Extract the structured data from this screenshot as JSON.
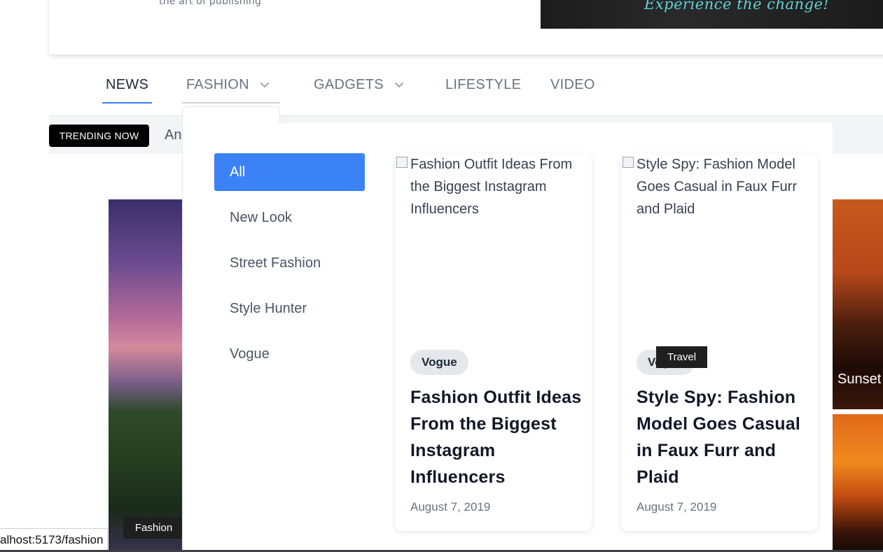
{
  "header": {
    "tagline": "the art of publishing",
    "ad_text": "Experience the change!"
  },
  "nav": {
    "items": [
      {
        "label": "NEWS",
        "active": true,
        "has_dropdown": false
      },
      {
        "label": "FASHION",
        "active": false,
        "has_dropdown": true,
        "open": true
      },
      {
        "label": "GADGETS",
        "active": false,
        "has_dropdown": true
      },
      {
        "label": "LIFESTYLE",
        "active": false,
        "has_dropdown": false
      },
      {
        "label": "VIDEO",
        "active": false,
        "has_dropdown": false
      }
    ],
    "active_color": "#3b82f6"
  },
  "trending": {
    "badge": "TRENDING NOW",
    "text": "An"
  },
  "mega_menu": {
    "categories": [
      {
        "label": "All",
        "active": true
      },
      {
        "label": "New Look"
      },
      {
        "label": "Street Fashion"
      },
      {
        "label": "Style Hunter"
      },
      {
        "label": "Vogue"
      }
    ],
    "cards": [
      {
        "image_alt": "Fashion Outfit Ideas From the Biggest Instagram Influencers",
        "category": "Vogue",
        "title": "Fashion Outfit Ideas From the Biggest Instagram Influencers",
        "date": "August 7, 2019"
      },
      {
        "image_alt": "Style Spy: Fashion Model Goes Casual in Faux Furr and Plaid",
        "category": "Vogue",
        "title": "Style Spy: Fashion Model Goes Casual in Faux Furr and Plaid",
        "date": "August 7, 2019"
      }
    ]
  },
  "background": {
    "right_hero_label": "Sunset",
    "fashion_tag": "Fashion",
    "travel_tag": "Travel"
  },
  "status_bar": {
    "url": "alhost:5173/fashion"
  },
  "colors": {
    "accent": "#3b82f6",
    "tag_bg": "#1f1f1f",
    "pill_bg": "#e5e7eb"
  }
}
